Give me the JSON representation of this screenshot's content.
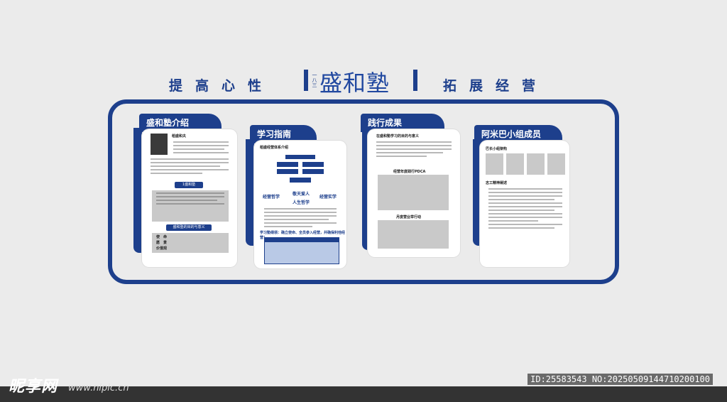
{
  "header": {
    "left_slogan": "提高心性",
    "right_slogan": "拓展经营",
    "brand_name": "盛和塾",
    "brand_sub": "一八三"
  },
  "panels": [
    {
      "tab": "盛和塾介绍",
      "name_heading": "稻盛和夫",
      "btn1": "1盛和塾",
      "btn2": "盛和塾的目的与意义",
      "rows": [
        "使　命",
        "愿　景",
        "价值观"
      ]
    },
    {
      "tab": "学习指南",
      "subtitle": "稻盛经营体系介绍",
      "tags": [
        "经营哲学",
        "敬天爱人",
        "经营实学",
        "人生哲学"
      ],
      "table_caption": "学习塾纲领：确立使命、全员参入经营，并确保利他经营！"
    },
    {
      "tab": "践行成果",
      "subtitle": "在盛和塾学习的目的与意义",
      "box1_caption": "经营年度践行PDCA",
      "box2_caption": "月度营业举行动"
    },
    {
      "tab": "阿米巴小组成员",
      "subtitle": "巴长小组架构",
      "section2": "志工精神阐述"
    }
  ],
  "watermark": {
    "logo": "昵享网",
    "url": "www.nipic.cn",
    "id_text": "ID:25583543 NO:20250509144710200100"
  }
}
